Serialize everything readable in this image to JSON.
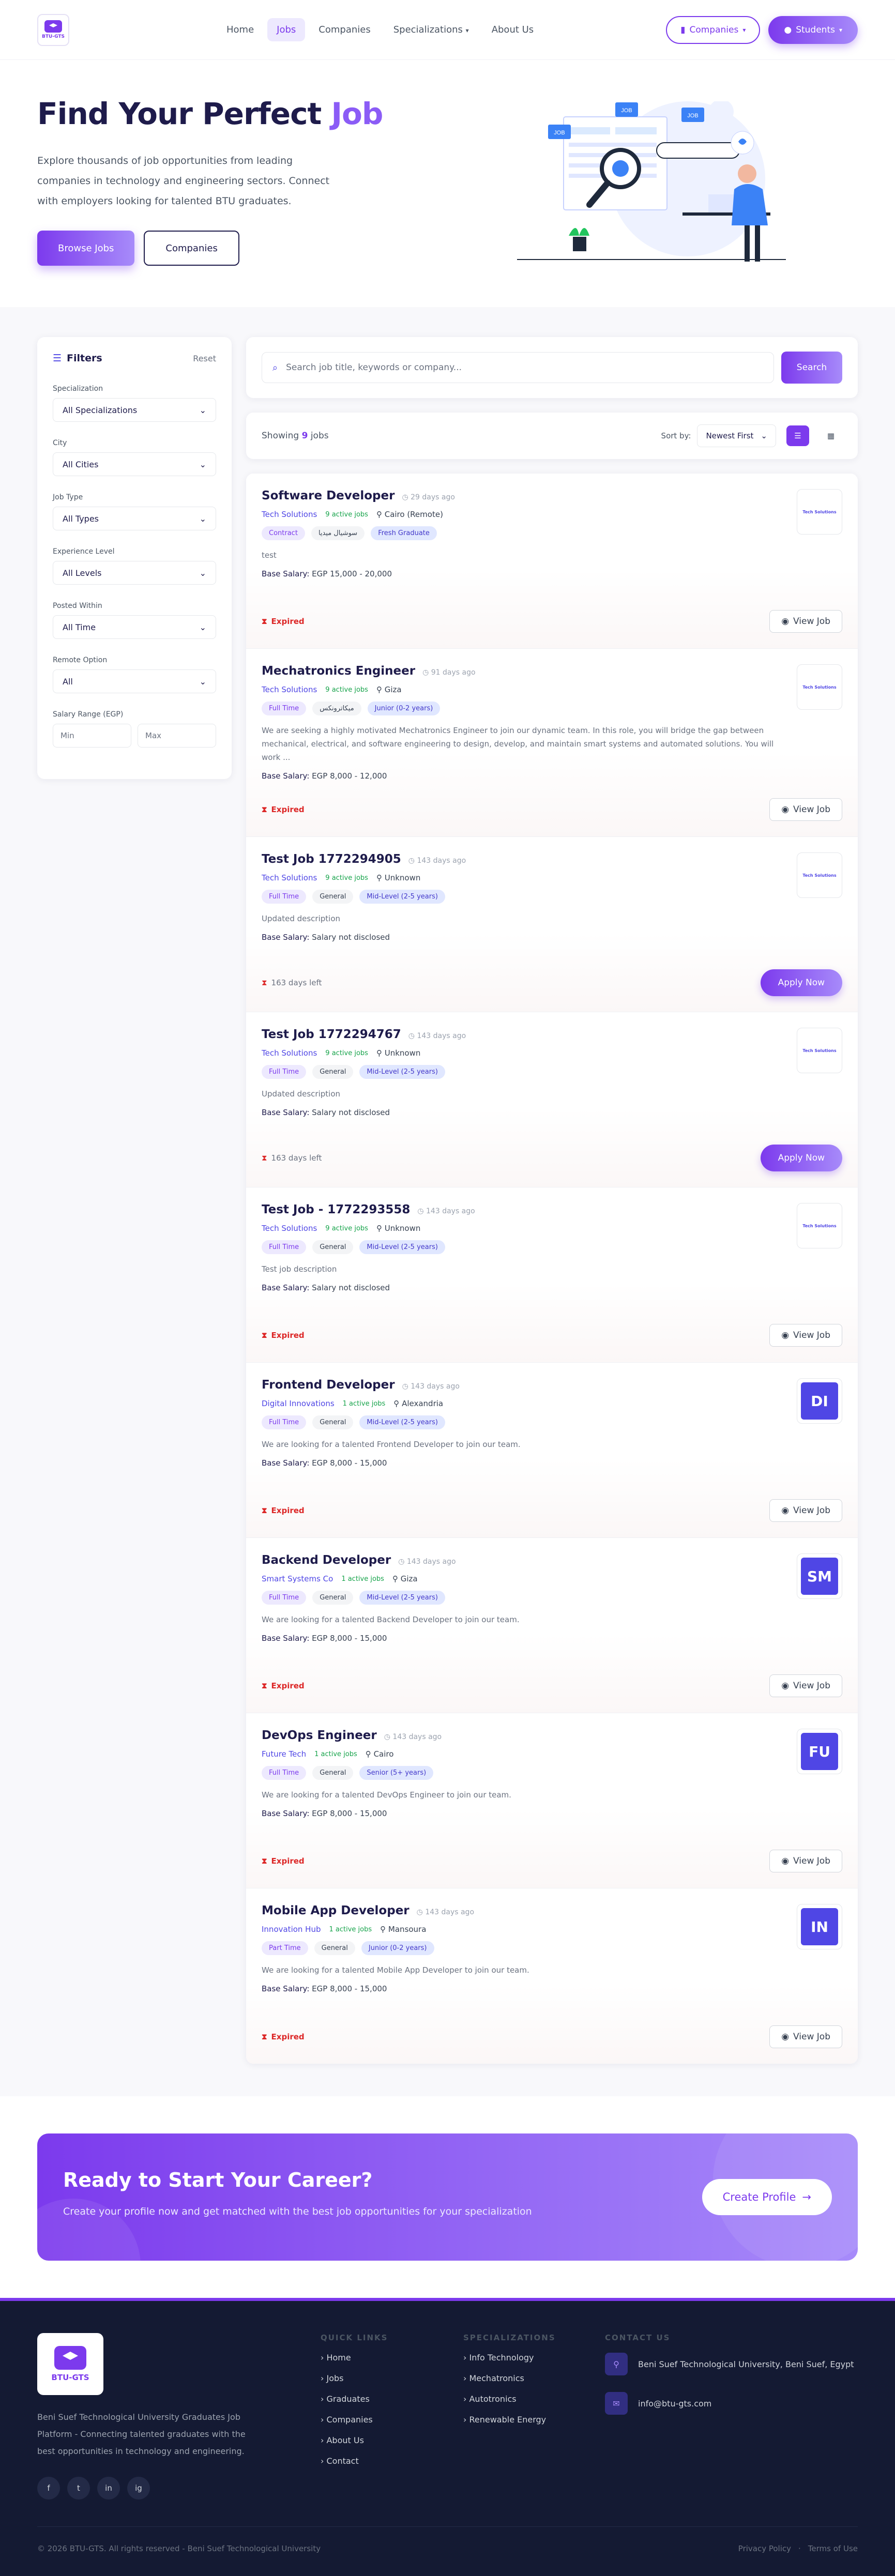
{
  "nav": {
    "logo_text": "BTU-GTS",
    "links": [
      "Home",
      "Jobs",
      "Companies",
      "Specializations",
      "About Us"
    ],
    "companies_btn": "Companies",
    "students_btn": "Students"
  },
  "hero": {
    "title_part1": "Find Your Perfect ",
    "title_part2": "Job",
    "subtitle": "Explore thousands of job opportunities from leading companies in technology and engineering sectors. Connect with employers looking for talented BTU graduates.",
    "browse_btn": "Browse Jobs",
    "companies_btn": "Companies",
    "illus_label_1": "JOB",
    "illus_label_2": "JOB",
    "illus_label_3": "JOB"
  },
  "filters": {
    "title": "Filters",
    "reset": "Reset",
    "groups": [
      {
        "label": "Specialization",
        "value": "All Specializations"
      },
      {
        "label": "City",
        "value": "All Cities"
      },
      {
        "label": "Job Type",
        "value": "All Types"
      },
      {
        "label": "Experience Level",
        "value": "All Levels"
      },
      {
        "label": "Posted Within",
        "value": "All Time"
      },
      {
        "label": "Remote Option",
        "value": "All"
      }
    ],
    "salary_label": "Salary Range (EGP)",
    "min_placeholder": "Min",
    "max_placeholder": "Max"
  },
  "search": {
    "placeholder": "Search job title, keywords or company...",
    "button": "Search"
  },
  "results": {
    "showing": "Showing",
    "count": "9",
    "suffix": "jobs",
    "sort_label": "Sort by:",
    "sort_value": "Newest First"
  },
  "jobs": [
    {
      "title": "Software Developer",
      "ago": "29 days ago",
      "company": "Tech Solutions",
      "active": "9 active jobs",
      "location": "Cairo (Remote)",
      "tags": [
        "Contract",
        "سوشيال ميديا",
        "Fresh Graduate"
      ],
      "description": "test",
      "salary_label": "Base Salary:",
      "salary": "EGP 15,000 - 20,000",
      "status": "Expired",
      "action": "View Job",
      "logo_text": "Tech Solutions"
    },
    {
      "title": "Mechatronics Engineer",
      "ago": "91 days ago",
      "company": "Tech Solutions",
      "active": "9 active jobs",
      "location": "Giza",
      "tags": [
        "Full Time",
        "ميكاترونكس",
        "Junior (0-2 years)"
      ],
      "description": "We are seeking a highly motivated Mechatronics Engineer to join our dynamic team. In this role, you will bridge the gap between mechanical, electrical, and software engineering to design, develop, and maintain smart systems and automated solutions. You will work ...",
      "salary_label": "Base Salary:",
      "salary": "EGP 8,000 - 12,000",
      "status": "Expired",
      "action": "View Job",
      "logo_text": "Tech Solutions"
    },
    {
      "title": "Test Job 1772294905",
      "ago": "143 days ago",
      "company": "Tech Solutions",
      "active": "9 active jobs",
      "location": "Unknown",
      "tags": [
        "Full Time",
        "General",
        "Mid-Level (2-5 years)"
      ],
      "description": "Updated description",
      "salary_label": "Base Salary:",
      "salary": "Salary not disclosed",
      "status": "163 days left",
      "action": "Apply Now",
      "logo_text": "Tech Solutions"
    },
    {
      "title": "Test Job 1772294767",
      "ago": "143 days ago",
      "company": "Tech Solutions",
      "active": "9 active jobs",
      "location": "Unknown",
      "tags": [
        "Full Time",
        "General",
        "Mid-Level (2-5 years)"
      ],
      "description": "Updated description",
      "salary_label": "Base Salary:",
      "salary": "Salary not disclosed",
      "status": "163 days left",
      "action": "Apply Now",
      "logo_text": "Tech Solutions"
    },
    {
      "title": "Test Job - 1772293558",
      "ago": "143 days ago",
      "company": "Tech Solutions",
      "active": "9 active jobs",
      "location": "Unknown",
      "tags": [
        "Full Time",
        "General",
        "Mid-Level (2-5 years)"
      ],
      "description": "Test job description",
      "salary_label": "Base Salary:",
      "salary": "Salary not disclosed",
      "status": "Expired",
      "action": "View Job",
      "logo_text": "Tech Solutions"
    },
    {
      "title": "Frontend Developer",
      "ago": "143 days ago",
      "company": "Digital Innovations",
      "active": "1 active jobs",
      "location": "Alexandria",
      "tags": [
        "Full Time",
        "General",
        "Mid-Level (2-5 years)"
      ],
      "description": "We are looking for a talented Frontend Developer to join our team.",
      "salary_label": "Base Salary:",
      "salary": "EGP 8,000 - 15,000",
      "status": "Expired",
      "action": "View Job",
      "initials": "DI"
    },
    {
      "title": "Backend Developer",
      "ago": "143 days ago",
      "company": "Smart Systems Co",
      "active": "1 active jobs",
      "location": "Giza",
      "tags": [
        "Full Time",
        "General",
        "Mid-Level (2-5 years)"
      ],
      "description": "We are looking for a talented Backend Developer to join our team.",
      "salary_label": "Base Salary:",
      "salary": "EGP 8,000 - 15,000",
      "status": "Expired",
      "action": "View Job",
      "initials": "SM"
    },
    {
      "title": "DevOps Engineer",
      "ago": "143 days ago",
      "company": "Future Tech",
      "active": "1 active jobs",
      "location": "Cairo",
      "tags": [
        "Full Time",
        "General",
        "Senior (5+ years)"
      ],
      "description": "We are looking for a talented DevOps Engineer to join our team.",
      "salary_label": "Base Salary:",
      "salary": "EGP 8,000 - 15,000",
      "status": "Expired",
      "action": "View Job",
      "initials": "FU"
    },
    {
      "title": "Mobile App Developer",
      "ago": "143 days ago",
      "company": "Innovation Hub",
      "active": "1 active jobs",
      "location": "Mansoura",
      "tags": [
        "Part Time",
        "General",
        "Junior (0-2 years)"
      ],
      "description": "We are looking for a talented Mobile App Developer to join our team.",
      "salary_label": "Base Salary:",
      "salary": "EGP 8,000 - 15,000",
      "status": "Expired",
      "action": "View Job",
      "initials": "IN"
    }
  ],
  "cta": {
    "title": "Ready to Start Your Career?",
    "subtitle": "Create your profile now and get matched with the best job opportunities for your specialization",
    "button": "Create Profile"
  },
  "footer": {
    "logo_text": "BTU-GTS",
    "about": "Beni Suef Technological University Graduates Job Platform - Connecting talented graduates with the best opportunities in technology and engineering.",
    "social": [
      "f",
      "t",
      "in",
      "ig"
    ],
    "quick_links_title": "QUICK LINKS",
    "quick_links": [
      "Home",
      "Jobs",
      "Graduates",
      "Companies",
      "About Us",
      "Contact"
    ],
    "specializations_title": "SPECIALIZATIONS",
    "specializations": [
      "Info Technology",
      "Mechatronics",
      "Autotronics",
      "Renewable Energy"
    ],
    "contact_title": "CONTACT US",
    "address": "Beni Suef Technological University, Beni Suef, Egypt",
    "email": "info@btu-gts.com",
    "copyright": "© 2026 BTU-GTS. All rights reserved - Beni Suef Technological University",
    "privacy": "Privacy Policy",
    "sep": "·",
    "terms": "Terms of Use"
  },
  "colors": {
    "primary": "#7c3aed",
    "primary_light": "#a78bfa",
    "dark": "#1e1b4b",
    "expired": "#dc2626",
    "footer_bg": "#141a33"
  }
}
